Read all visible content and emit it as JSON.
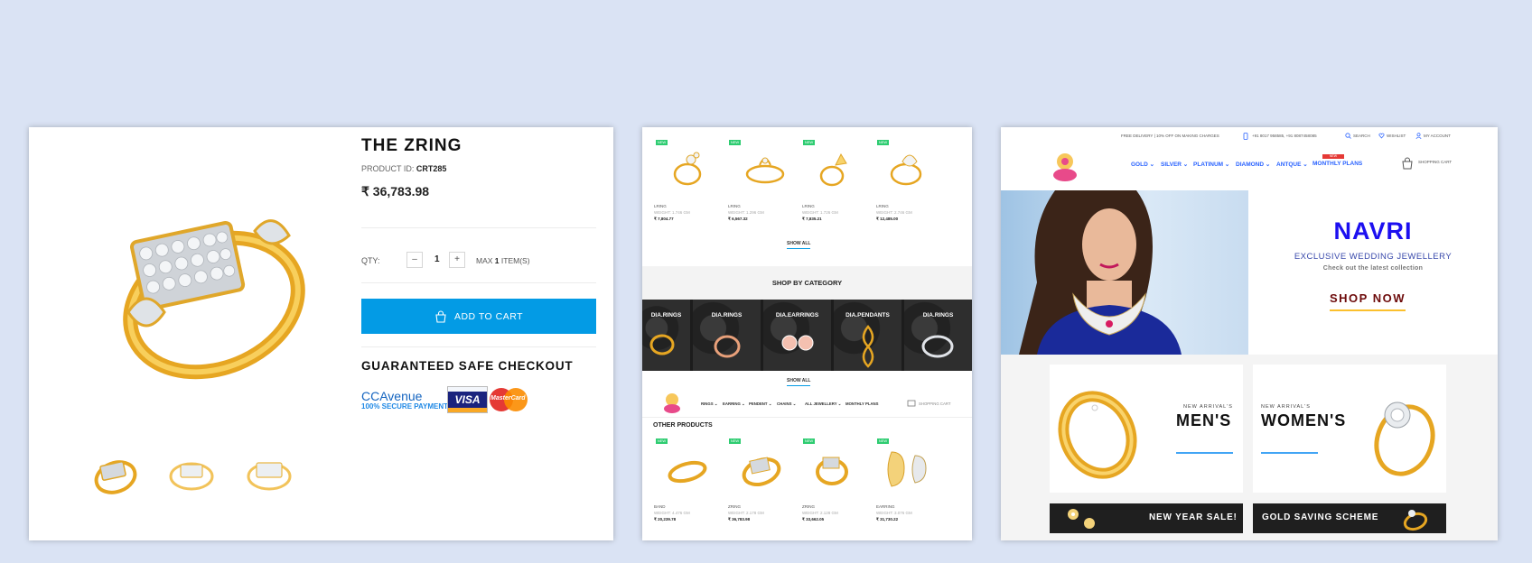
{
  "product": {
    "title": "THE ZRING",
    "product_id_label": "PRODUCT ID:",
    "product_id": "CRT285",
    "price": "₹ 36,783.98",
    "qty_label": "QTY:",
    "qty_minus": "–",
    "qty_value": "1",
    "qty_plus": "+",
    "max_label": "MAX",
    "max_value": "1",
    "max_suffix": "ITEM(S)",
    "add_to_cart": "ADD TO CART",
    "guaranteed": "GUARANTEED SAFE CHECKOUT",
    "ccavenue": "CCAvenue",
    "ccavenue_sub": "100% SECURE PAYMENT",
    "visa": "VISA",
    "mastercard": "MasterCard"
  },
  "listing": {
    "new_badge": "NEW",
    "top_products": [
      {
        "name": "LRING",
        "meta": "WEIGHT: 1.746 GM",
        "price": "₹ 7,804.77"
      },
      {
        "name": "LRING",
        "meta": "WEIGHT: 1.296 GM",
        "price": "₹ 6,567.32"
      },
      {
        "name": "LRING",
        "meta": "WEIGHT: 1.726 GM",
        "price": "₹ 7,835.21"
      },
      {
        "name": "LRING",
        "meta": "WEIGHT: 2.746 GM",
        "price": "₹ 12,485.00"
      }
    ],
    "show_all": "SHOW ALL",
    "shop_by_category": "SHOP BY CATEGORY",
    "categories": [
      "DIA.RINGS",
      "DIA.RINGS",
      "DIA.EARRINGS",
      "DIA.PENDANTS",
      "DIA.RINGS"
    ],
    "nav": [
      "RINGS ⌄",
      "EARRING ⌄",
      "PENDENT ⌄",
      "CHAINS ⌄",
      "ALL JEWELLERY ⌄",
      "MONTHLY PLANS"
    ],
    "nav_cart": "SHOPPING CART",
    "other_products_title": "OTHER PRODUCTS",
    "other_products": [
      {
        "name": "BAND",
        "meta": "WEIGHT: 4.476 GM",
        "price": "₹ 20,239.78"
      },
      {
        "name": "ZRING",
        "meta": "WEIGHT: 2.178 GM",
        "price": "₹ 36,783.98"
      },
      {
        "name": "ZRING",
        "meta": "WEIGHT: 2.128 GM",
        "price": "₹ 33,662.05"
      },
      {
        "name": "EARRING",
        "meta": "WEIGHT: 3.076 GM",
        "price": "₹ 31,730.22"
      }
    ]
  },
  "home": {
    "topbar_delivery": "FREE DELIVERY | 10% OFF ON MAKING CHARGES",
    "topbar_phone": "+91 8017 958585, +91 8087458085",
    "topbar_search": "SEARCH",
    "topbar_wishlist": "WISHLIST",
    "topbar_account": "MY ACCOUNT",
    "nav": [
      "GOLD ⌄",
      "SILVER ⌄",
      "PLATINUM ⌄",
      "DIAMOND ⌄",
      "ANTQUE ⌄",
      "MONTHLY PLANS"
    ],
    "plans_badge": "NEW SCHEME",
    "cart_label": "SHOPPING CART",
    "hero_title": "NAVRI",
    "hero_sub": "EXCLUSIVE WEDDING JEWELLERY",
    "hero_check": "Check out the latest collection",
    "hero_cta": "SHOP NOW",
    "mens_new": "NEW ARRIVAL'S",
    "mens": "MEN'S",
    "womens_new": "NEW ARRIVAL'S",
    "womens": "WOMEN'S",
    "banner_sale": "NEW YEAR SALE!",
    "banner_gold": "GOLD SAVING SCHEME"
  },
  "colors": {
    "accent": "#039be5",
    "gold": "#f5b82a",
    "navri_blue": "#1c0ff0",
    "new_badge": "#2ecc71"
  }
}
